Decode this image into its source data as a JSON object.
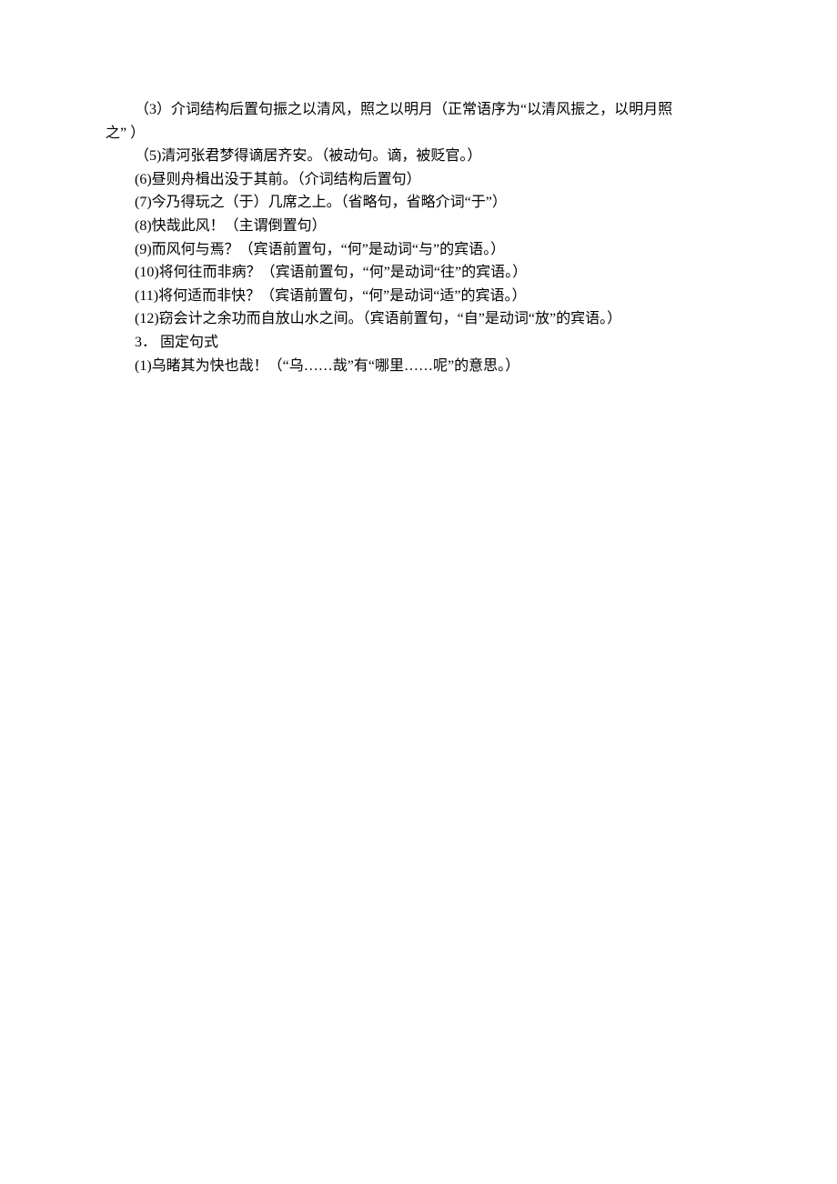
{
  "lines": [
    {
      "text": "（3）介词结构后置句振之以清风，照之以明月（正常语序为“以清风振之，以明月照",
      "indent": true
    },
    {
      "text": "之” ）",
      "indent": false
    },
    {
      "text": "（5)清河张君梦得谪居齐安。（被动句。谪，被贬官。）",
      "indent": true
    },
    {
      "text": "(6)昼则舟楫出没于其前。（介词结构后置句）",
      "indent": true
    },
    {
      "text": "(7)今乃得玩之（于）几席之上。（省略句，省略介词“于”）",
      "indent": true
    },
    {
      "text": "(8)快哉此风！（主谓倒置句）",
      "indent": true
    },
    {
      "text": "(9)而风何与焉？（宾语前置句，“何”是动词“与”的宾语。）",
      "indent": true
    },
    {
      "text": "(10)将何往而非病？（宾语前置句，“何”是动词“往”的宾语。）",
      "indent": true
    },
    {
      "text": "(11)将何适而非快？（宾语前置句，“何”是动词“适”的宾语。）",
      "indent": true
    },
    {
      "text": "(12)窃会计之余功而自放山水之间。（宾语前置句，“自”是动词“放”的宾语。）",
      "indent": true
    },
    {
      "text": "3． 固定句式",
      "indent": true
    },
    {
      "text": "(1)乌睹其为快也哉！（“乌……哉”有“哪里……呢”的意思。）",
      "indent": true
    }
  ]
}
